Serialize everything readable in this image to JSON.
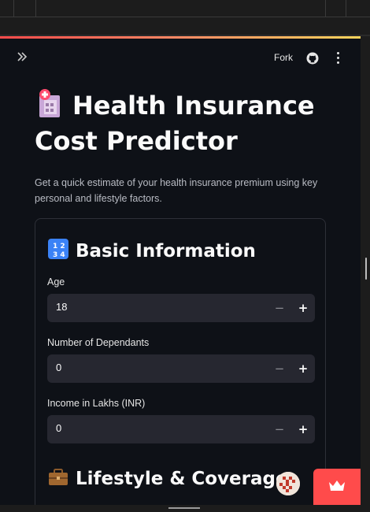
{
  "header": {
    "expand_icon": "double-chevron-right-icon",
    "fork_label": "Fork",
    "github_icon": "github-icon",
    "menu_icon": "kebab-menu-icon"
  },
  "page": {
    "title_icon": "hospital-icon",
    "title": "Health Insurance Cost Predictor",
    "subtitle": "Get a quick estimate of your health insurance premium using key personal and lifestyle factors."
  },
  "sections": [
    {
      "icon": "input-numbers-icon",
      "heading": "Basic Information",
      "fields": [
        {
          "label": "Age",
          "value": "18"
        },
        {
          "label": "Number of Dependants",
          "value": "0"
        },
        {
          "label": "Income in Lakhs (INR)",
          "value": "0"
        }
      ]
    },
    {
      "icon": "briefcase-icon",
      "heading": "Lifestyle & Coverage"
    }
  ],
  "stepper": {
    "minus": "−",
    "plus": "+"
  },
  "footer": {
    "avatar_icon": "user-avatar",
    "badge_icon": "crown-icon"
  },
  "colors": {
    "background": "#0e1117",
    "input_bg": "#262730",
    "accent": "#ff4b4b",
    "gradient": [
      "#ff4b4b",
      "#fdd55c"
    ]
  }
}
